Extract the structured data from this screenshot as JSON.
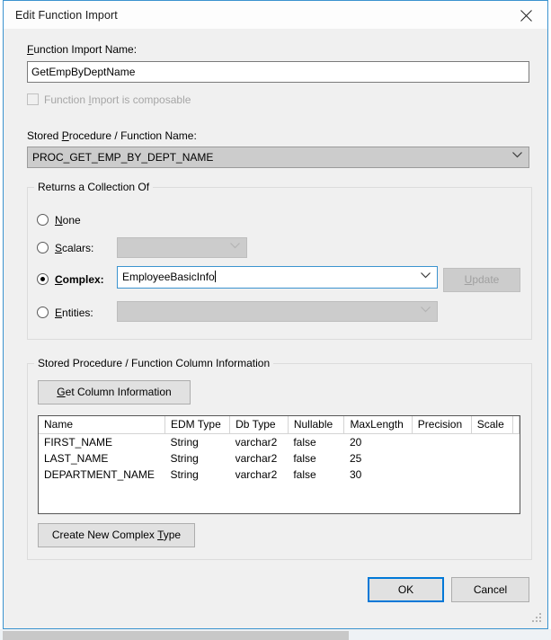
{
  "window": {
    "title": "Edit Function Import",
    "close_icon": "close-icon"
  },
  "form": {
    "function_import_name_label": "Function Import Name:",
    "function_import_name_label_mnemonic": "F",
    "function_import_name_value": "GetEmpByDeptName",
    "composable_checkbox_label_pre": "Function ",
    "composable_checkbox_label_mnemonic": "I",
    "composable_checkbox_label_post": "mport is composable",
    "composable_checked": false,
    "composable_enabled": false,
    "stored_procedure_label_pre": "Stored ",
    "stored_procedure_label_mnemonic": "P",
    "stored_procedure_label_post": "rocedure / Function Name:",
    "stored_procedure_value": "PROC_GET_EMP_BY_DEPT_NAME"
  },
  "returns_group": {
    "title": "Returns a Collection Of",
    "options": [
      {
        "id": "none",
        "label_pre": "",
        "mnemonic": "N",
        "label_post": "one",
        "selected": false,
        "has_field": false
      },
      {
        "id": "scalars",
        "label_pre": "",
        "mnemonic": "S",
        "label_post": "calars:",
        "selected": false,
        "has_field": true,
        "field_value": "",
        "field_enabled": false
      },
      {
        "id": "complex",
        "label_pre": "",
        "mnemonic": "C",
        "label_post": "omplex:",
        "selected": true,
        "has_field": true,
        "field_value": "EmployeeBasicInfo",
        "field_enabled": true
      },
      {
        "id": "entities",
        "label_pre": "",
        "mnemonic": "E",
        "label_post": "ntities:",
        "selected": false,
        "has_field": true,
        "field_value": "",
        "field_enabled": false
      }
    ],
    "update_button_label_pre": "",
    "update_button_mnemonic": "U",
    "update_button_label_post": "pdate",
    "update_button_enabled": false
  },
  "column_group": {
    "title": "Stored Procedure / Function Column Information",
    "get_column_button_label_pre": "",
    "get_column_button_mnemonic": "G",
    "get_column_button_label_post": "et Column Information",
    "create_complex_button_label_pre": "Create New Complex ",
    "create_complex_button_mnemonic": "T",
    "create_complex_button_label_post": "ype",
    "grid": {
      "headers": [
        "Name",
        "EDM Type",
        "Db Type",
        "Nullable",
        "MaxLength",
        "Precision",
        "Scale"
      ],
      "rows": [
        [
          "FIRST_NAME",
          "String",
          "varchar2",
          "false",
          "20",
          "",
          ""
        ],
        [
          "LAST_NAME",
          "String",
          "varchar2",
          "false",
          "25",
          "",
          ""
        ],
        [
          "DEPARTMENT_NAME",
          "String",
          "varchar2",
          "false",
          "30",
          "",
          ""
        ]
      ]
    }
  },
  "footer": {
    "ok_label": "OK",
    "cancel_label": "Cancel",
    "ok_is_default": true
  },
  "colors": {
    "window_border": "#3b93cf",
    "dialog_background": "#f0f0f0",
    "focus_blue": "#0078d7",
    "field_focus_border": "#3b93cf",
    "disabled_gray": "#cccccc",
    "text": "#000000"
  }
}
